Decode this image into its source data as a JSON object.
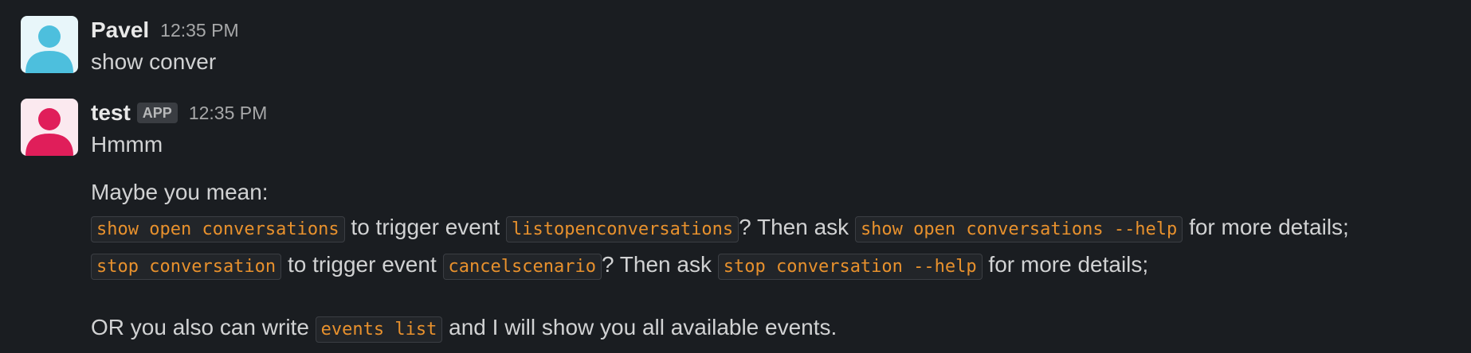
{
  "messages": [
    {
      "sender": "Pavel",
      "timestamp": "12:35 PM",
      "avatar_color": "#4dbfdd",
      "text": "show conver"
    },
    {
      "sender": "test",
      "badge": "APP",
      "timestamp": "12:35 PM",
      "avatar_color": "#e01e5a",
      "greeting": "Hmmm",
      "intro": "Maybe you mean:",
      "suggestions": [
        {
          "command": "show open conversations",
          "trigger_text": " to trigger event ",
          "event": "listopenconversations",
          "ask_text": "? Then ask ",
          "help": "show open conversations --help",
          "tail_text": " for more details;"
        },
        {
          "command": "stop conversation",
          "trigger_text": " to trigger event ",
          "event": "cancelscenario",
          "ask_text": "? Then ask ",
          "help": "stop conversation --help",
          "tail_text": " for more details;"
        }
      ],
      "footer_before": "OR you also can write ",
      "footer_code": "events list",
      "footer_after": " and I will show you all available events."
    }
  ],
  "colors": {
    "background": "#1a1d21",
    "code_text": "#e8912d",
    "code_bg": "#222529"
  }
}
